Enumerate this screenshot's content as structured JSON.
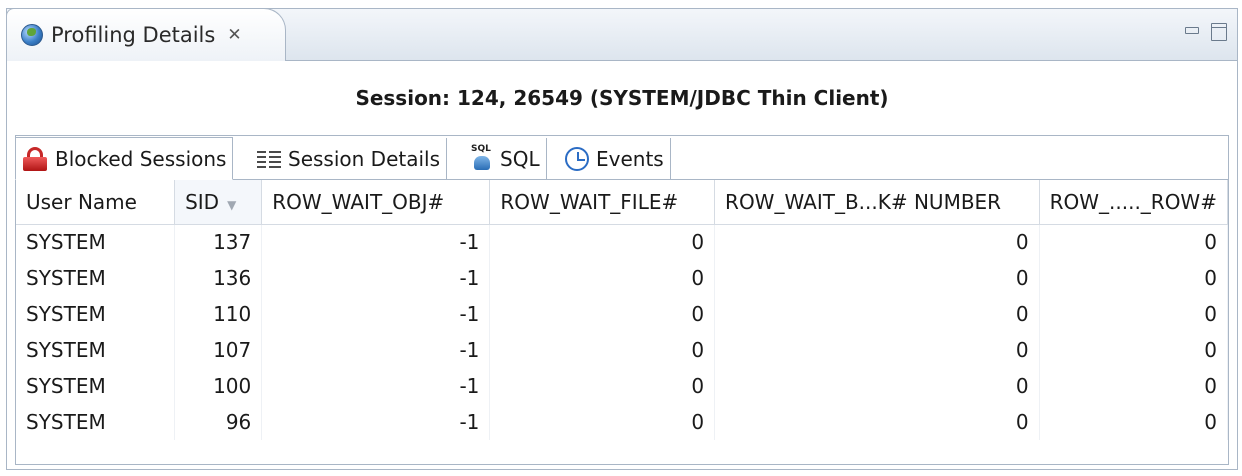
{
  "view": {
    "tab_label": "Profiling Details",
    "close_glyph": "✕",
    "icon": "globe-icon"
  },
  "session": {
    "title": "Session: 124, 26549 (SYSTEM/JDBC Thin Client)"
  },
  "tabs": [
    {
      "label": "Blocked Sessions",
      "icon": "lock-icon",
      "active": true
    },
    {
      "label": "Session Details",
      "icon": "columns-icon",
      "active": false
    },
    {
      "label": "SQL",
      "icon": "sql-icon",
      "active": false
    },
    {
      "label": "Events",
      "icon": "clock-icon",
      "active": false
    }
  ],
  "sql_icon_text": "SQL",
  "table": {
    "columns": [
      "User Name",
      "SID",
      "ROW_WAIT_OBJ#",
      "ROW_WAIT_FILE#",
      "ROW_WAIT_B...K# NUMBER",
      "ROW_....._ROW#"
    ],
    "sorted_column": "SID",
    "sort_glyph": "▼",
    "rows": [
      [
        "SYSTEM",
        "137",
        "-1",
        "0",
        "0",
        "0"
      ],
      [
        "SYSTEM",
        "136",
        "-1",
        "0",
        "0",
        "0"
      ],
      [
        "SYSTEM",
        "110",
        "-1",
        "0",
        "0",
        "0"
      ],
      [
        "SYSTEM",
        "107",
        "-1",
        "0",
        "0",
        "0"
      ],
      [
        "SYSTEM",
        "100",
        "-1",
        "0",
        "0",
        "0"
      ],
      [
        "SYSTEM",
        "96",
        "-1",
        "0",
        "0",
        "0"
      ]
    ]
  }
}
